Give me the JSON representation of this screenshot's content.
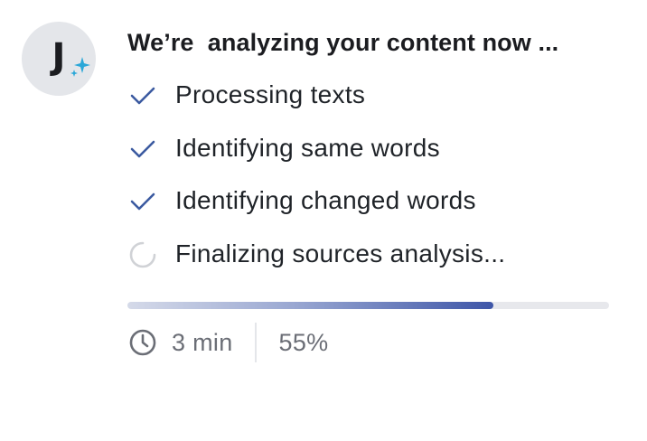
{
  "avatar": {
    "letter": "J",
    "icon": "sparkle-icon",
    "sparkle_color": "#2aa7d8"
  },
  "title": "We’re  analyzing your content now ...",
  "steps": [
    {
      "label": "Processing texts",
      "status": "done",
      "icon": "checkmark-icon"
    },
    {
      "label": "Identifying same words",
      "status": "done",
      "icon": "checkmark-icon"
    },
    {
      "label": "Identifying changed words",
      "status": "done",
      "icon": "checkmark-icon"
    },
    {
      "label": "Finalizing sources analysis...",
      "status": "in-progress",
      "icon": "spinner-icon"
    }
  ],
  "progress": {
    "percent": 55,
    "fill_fraction": 0.76,
    "accent_color": "#3e56a8",
    "track_color": "#e7e8ec"
  },
  "meta": {
    "time_icon": "clock-icon",
    "time_text": "3 min",
    "percent_text": "55%"
  },
  "colors": {
    "check": "#3b5aa0",
    "spinner": "#d0d2d6",
    "muted_text": "#6b6e76"
  }
}
